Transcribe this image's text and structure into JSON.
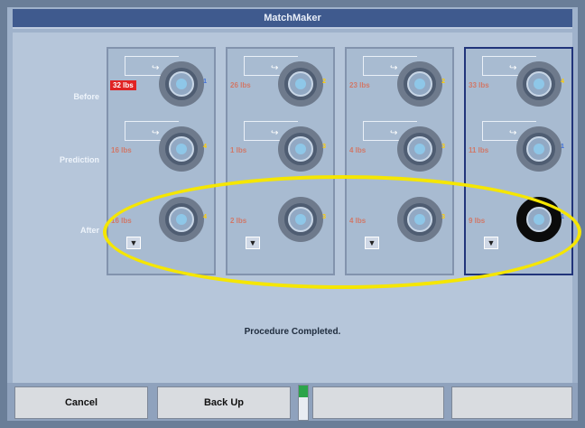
{
  "window": {
    "title": "MatchMaker"
  },
  "rows": {
    "before": "Before",
    "prediction": "Prediction",
    "after": "After"
  },
  "panels": [
    {
      "before": {
        "weight": "32 lbs",
        "alert": true,
        "marker": "1"
      },
      "prediction": {
        "weight": "16 lbs",
        "marker": "4"
      },
      "after": {
        "weight": "16 lbs",
        "marker": "4"
      }
    },
    {
      "before": {
        "weight": "26 lbs",
        "marker": "2"
      },
      "prediction": {
        "weight": "1 lbs",
        "marker": "3"
      },
      "after": {
        "weight": "2 lbs",
        "marker": "3"
      }
    },
    {
      "before": {
        "weight": "23 lbs",
        "marker": "2"
      },
      "prediction": {
        "weight": "4 lbs",
        "marker": "3"
      },
      "after": {
        "weight": "4 lbs",
        "marker": "3"
      }
    },
    {
      "before": {
        "weight": "33 lbs",
        "marker": "4"
      },
      "prediction": {
        "weight": "11 lbs",
        "marker": "1"
      },
      "after": {
        "weight": "9 lbs",
        "marker": "1"
      }
    }
  ],
  "status_text": "Procedure Completed.",
  "buttons": {
    "cancel": "Cancel",
    "back_up": "Back Up",
    "blank_1": "",
    "blank_2": ""
  },
  "progress": {
    "level": 0.35,
    "color": "#2ca44a"
  },
  "colors": {
    "highlight": "#f5e600",
    "alert": "#e02424",
    "title_bar": "#3f5a8e"
  }
}
